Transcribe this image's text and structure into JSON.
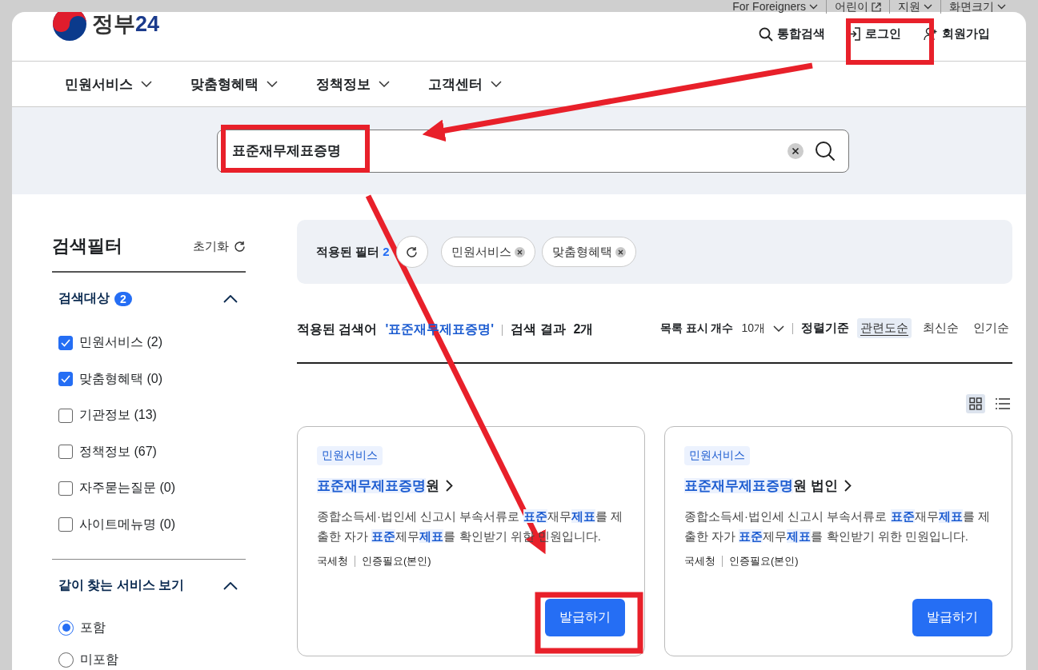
{
  "utility_links": [
    {
      "label": "For Foreigners",
      "kind": "dropdown"
    },
    {
      "label": "어린이",
      "kind": "external"
    },
    {
      "label": "지원",
      "kind": "dropdown"
    },
    {
      "label": "화면크기",
      "kind": "dropdown"
    }
  ],
  "logo": {
    "name": "정부",
    "number": "24"
  },
  "header_actions": [
    {
      "label": "통합검색",
      "kind": "search"
    },
    {
      "label": "로그인",
      "kind": "login"
    },
    {
      "label": "회원가입",
      "kind": "signup"
    }
  ],
  "nav": [
    "민원서비스",
    "맞춤형혜택",
    "정책정보",
    "고객센터"
  ],
  "search": {
    "value": "표준재무제표증명"
  },
  "filter_panel": {
    "title": "검색필터",
    "reset": "초기화",
    "sections": [
      {
        "title": "검색대상",
        "count": "2",
        "expanded": true,
        "kind": "checkbox",
        "options": [
          {
            "label": "민원서비스 (2)",
            "checked": true
          },
          {
            "label": "맞춤형혜택 (0)",
            "checked": true
          },
          {
            "label": "기관정보 (13)",
            "checked": false
          },
          {
            "label": "정책정보 (67)",
            "checked": false
          },
          {
            "label": "자주묻는질문 (0)",
            "checked": false
          },
          {
            "label": "사이트메뉴명 (0)",
            "checked": false
          }
        ]
      },
      {
        "title": "같이 찾는 서비스 보기",
        "expanded": true,
        "kind": "radio",
        "options": [
          {
            "label": "포함",
            "selected": true
          },
          {
            "label": "미포함",
            "selected": false
          }
        ]
      }
    ]
  },
  "applied_filters": {
    "label": "적용된 필터",
    "count": "2",
    "chips": [
      "민원서비스",
      "맞춤형혜택"
    ]
  },
  "results_summary": {
    "term_label": "적용된 검색어",
    "term": "'표준재무제표증명'",
    "result_label": "검색 결과",
    "result_count": "2개",
    "page_size_label": "목록 표시 개수",
    "page_size": "10개",
    "sort_label": "정렬기준",
    "sort_options": [
      {
        "label": "관련도순",
        "selected": true
      },
      {
        "label": "최신순",
        "selected": false
      },
      {
        "label": "인기순",
        "selected": false
      }
    ]
  },
  "view_modes": [
    {
      "kind": "grid",
      "selected": true
    },
    {
      "kind": "list",
      "selected": false
    }
  ],
  "cards": [
    {
      "category": "민원서비스",
      "title": "**표준재무제표증명**원",
      "description": "종합소득세·법인세 신고시 부속서류로 **표준**재무**제표**를 제출한 자가 **표준**제무**제표**를 확인받기 위한 민원입니다.",
      "agency": "국세청",
      "auth": "인증필요(본인)",
      "button": "발급하기"
    },
    {
      "category": "민원서비스",
      "title": "**표준재무제표증명**원 법인",
      "description": "종합소득세·법인세 신고시 부속서류로 **표준**재무**제표**를 제출한 자가 **표준**제무**제표**를 확인받기 위한 민원입니다.",
      "agency": "국세청",
      "auth": "인증필요(본인)",
      "button": "발급하기"
    }
  ]
}
